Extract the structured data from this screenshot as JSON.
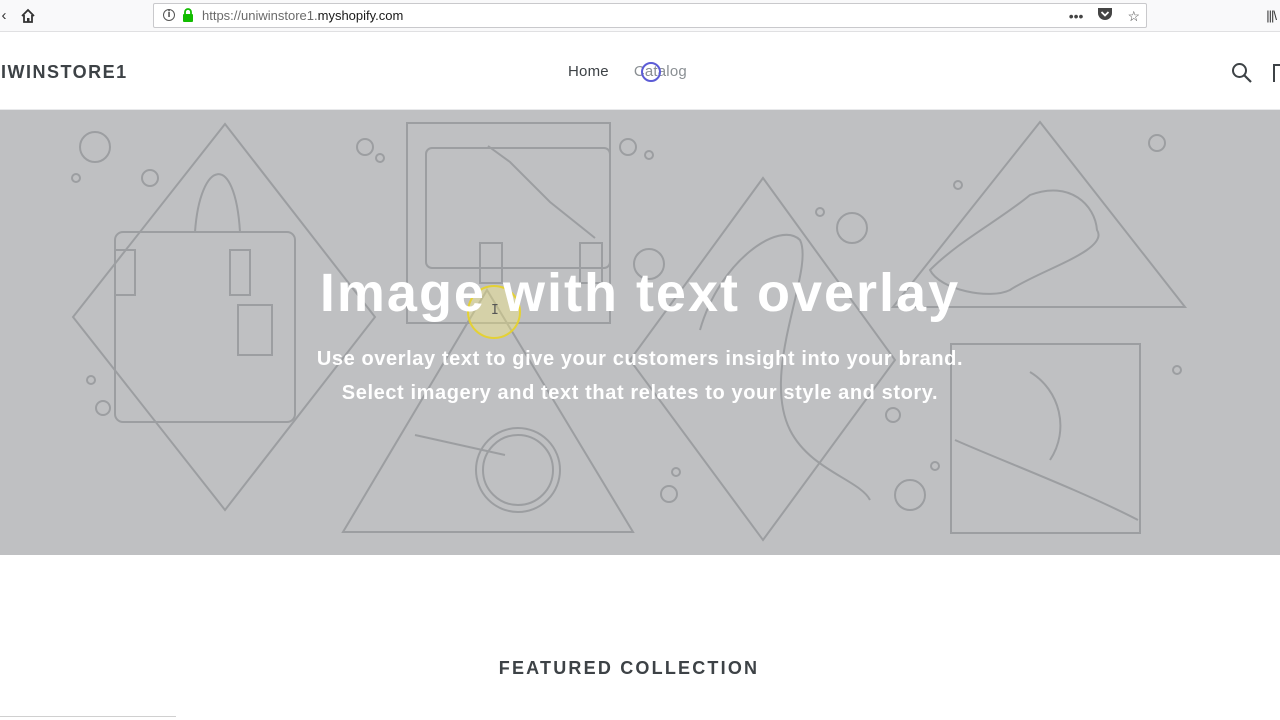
{
  "browser": {
    "url_prefix": "https://uniwinstore1.",
    "url_domain": "myshopify.com",
    "back_icon": "back-arrow-icon",
    "home_icon": "home-icon",
    "info_icon": "info-icon",
    "lock_icon": "lock-icon",
    "menu_icon": "more-dots-icon",
    "pocket_icon": "pocket-icon",
    "bookmark_icon": "star-icon",
    "library_icon": "library-icon"
  },
  "header": {
    "logo": "IWINSTORE1",
    "nav": [
      {
        "label": "Home"
      },
      {
        "label": "Catalog"
      }
    ],
    "search_icon": "search-icon",
    "cart_icon": "cart-icon"
  },
  "hero": {
    "title": "Image with text overlay",
    "subtitle_line1": "Use overlay text to give your customers insight into your brand.",
    "subtitle_line2": "Select imagery and text that relates to your style and story.",
    "background_color": "#bfc0c2"
  },
  "featured": {
    "heading": "FEATURED COLLECTION"
  },
  "colors": {
    "text": "#3d4246",
    "hero_text": "#ffffff",
    "link_muted": "#8a8f93"
  }
}
